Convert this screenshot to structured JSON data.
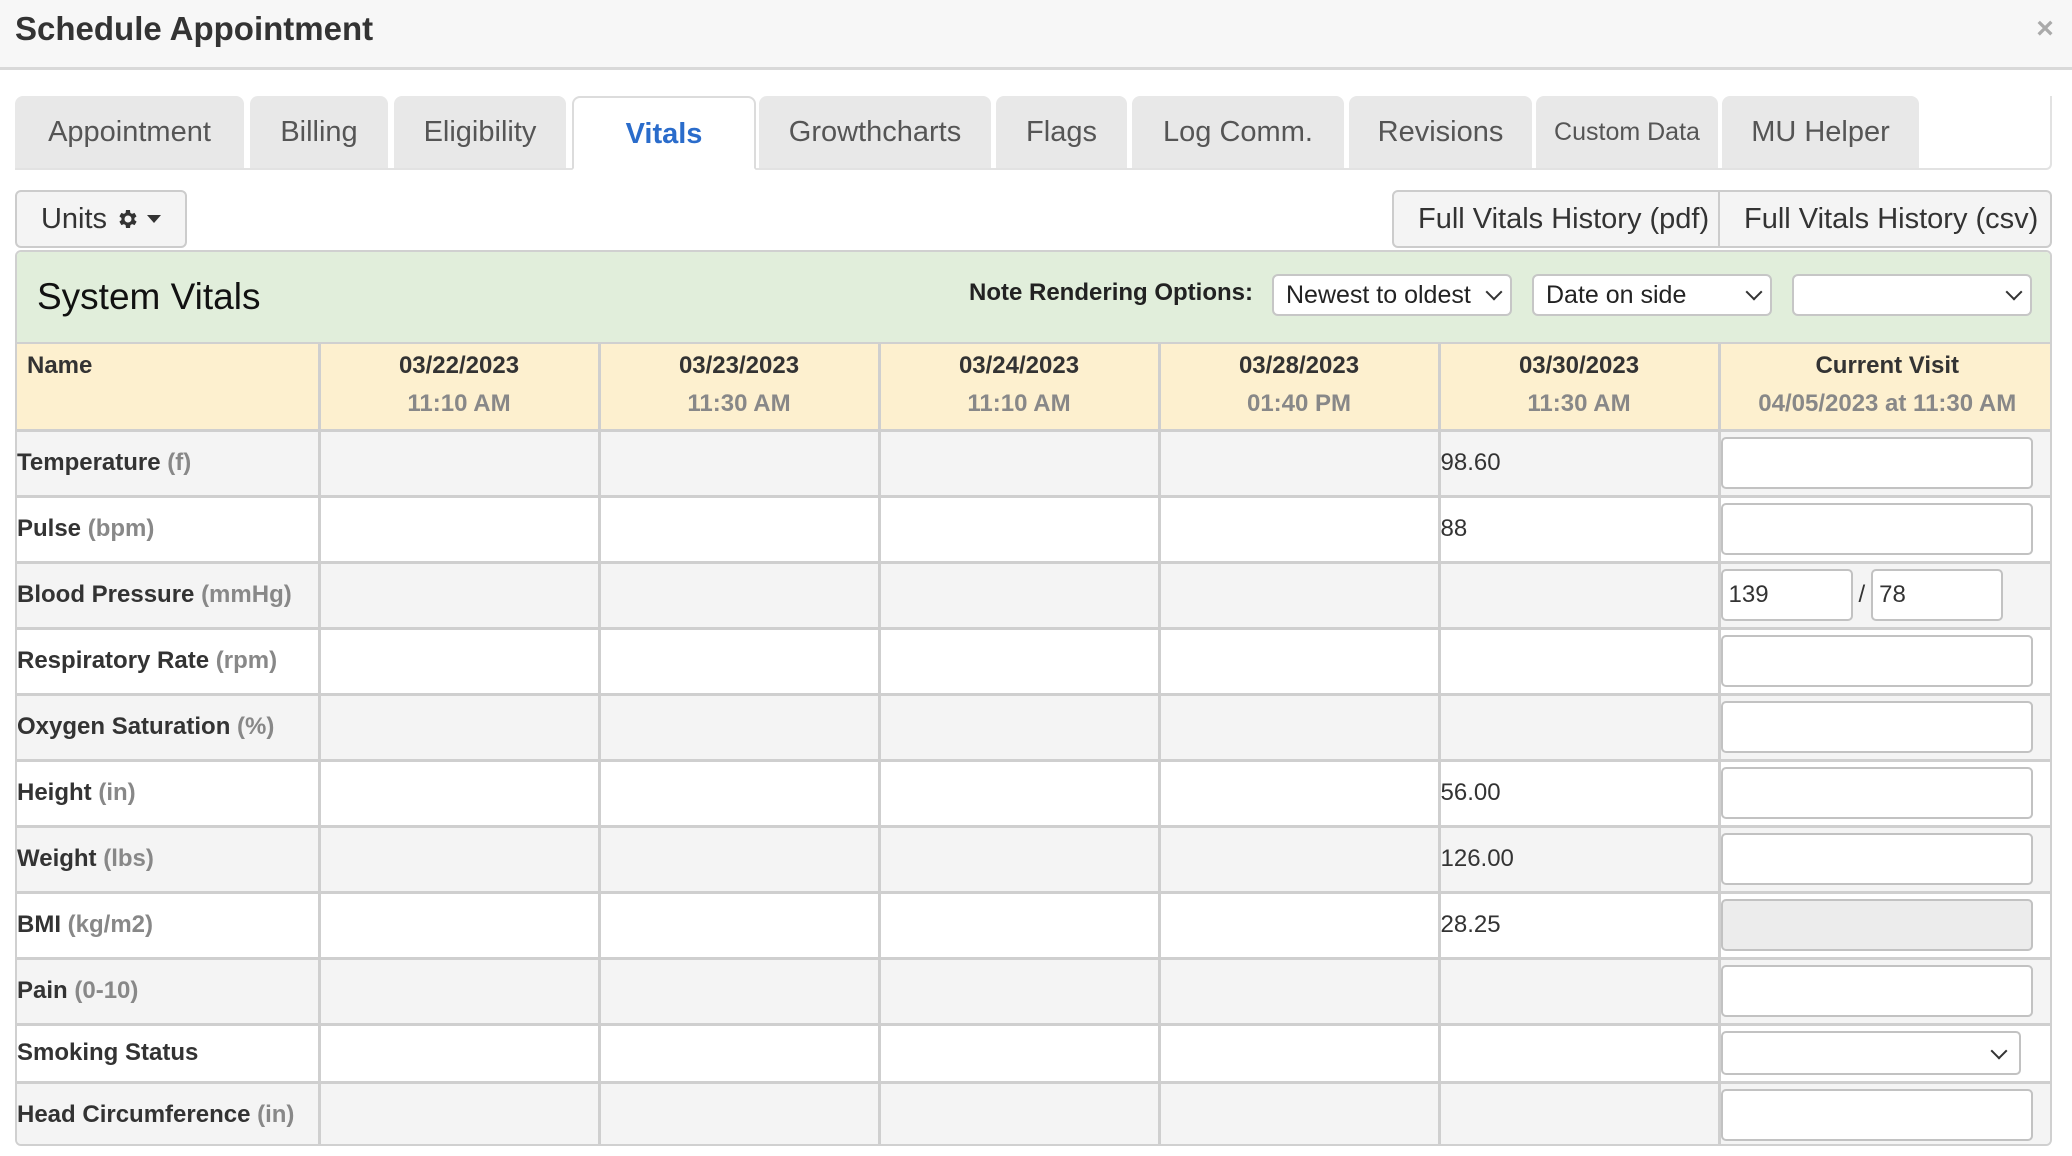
{
  "dialog": {
    "title": "Schedule Appointment",
    "close_icon": "×"
  },
  "tabs": [
    {
      "label": "Appointment",
      "active": false
    },
    {
      "label": "Billing",
      "active": false
    },
    {
      "label": "Eligibility",
      "active": false
    },
    {
      "label": "Vitals",
      "active": true
    },
    {
      "label": "Growthcharts",
      "active": false
    },
    {
      "label": "Flags",
      "active": false
    },
    {
      "label": "Log Comm.",
      "active": false
    },
    {
      "label": "Revisions",
      "active": false
    },
    {
      "label": "Custom Data",
      "active": false
    },
    {
      "label": "MU Helper",
      "active": false
    }
  ],
  "toolbar": {
    "units_label": "Units",
    "units_icon": "gear-icon",
    "pdf_label": "Full Vitals History (pdf)",
    "csv_label": "Full Vitals History (csv)"
  },
  "panel": {
    "title": "System Vitals",
    "note_rendering_label": "Note Rendering Options:",
    "order_select": "Newest to oldest",
    "date_select": "Date on side",
    "third_select": ""
  },
  "table": {
    "name_header": "Name",
    "columns": [
      {
        "date": "03/22/2023",
        "time": "11:10 AM"
      },
      {
        "date": "03/23/2023",
        "time": "11:30 AM"
      },
      {
        "date": "03/24/2023",
        "time": "11:10 AM"
      },
      {
        "date": "03/28/2023",
        "time": "01:40 PM"
      },
      {
        "date": "03/30/2023",
        "time": "11:30 AM"
      }
    ],
    "current_visit": {
      "title": "Current Visit",
      "subtitle": "04/05/2023 at 11:30 AM"
    },
    "rows": [
      {
        "name": "Temperature",
        "unit": "(f)",
        "values": [
          "",
          "",
          "",
          "",
          "98.60"
        ],
        "current": ""
      },
      {
        "name": "Pulse",
        "unit": "(bpm)",
        "values": [
          "",
          "",
          "",
          "",
          "88"
        ],
        "current": ""
      },
      {
        "name": "Blood Pressure",
        "unit": "(mmHg)",
        "values": [
          "",
          "",
          "",
          "",
          ""
        ],
        "current_systolic": "139",
        "current_diastolic": "78",
        "separator": "/"
      },
      {
        "name": "Respiratory Rate",
        "unit": "(rpm)",
        "values": [
          "",
          "",
          "",
          "",
          ""
        ],
        "current": ""
      },
      {
        "name": "Oxygen Saturation",
        "unit": "(%)",
        "values": [
          "",
          "",
          "",
          "",
          ""
        ],
        "current": ""
      },
      {
        "name": "Height",
        "unit": "(in)",
        "values": [
          "",
          "",
          "",
          "",
          "56.00"
        ],
        "current": ""
      },
      {
        "name": "Weight",
        "unit": "(lbs)",
        "values": [
          "",
          "",
          "",
          "",
          "126.00"
        ],
        "current": ""
      },
      {
        "name": "BMI",
        "unit": "(kg/m2)",
        "values": [
          "",
          "",
          "",
          "",
          "28.25"
        ],
        "current": ""
      },
      {
        "name": "Pain",
        "unit": "(0-10)",
        "values": [
          "",
          "",
          "",
          "",
          ""
        ],
        "current": ""
      },
      {
        "name": "Smoking Status",
        "unit": "",
        "values": [
          "",
          "",
          "",
          "",
          ""
        ],
        "current": ""
      },
      {
        "name": "Head Circumference",
        "unit": "(in)",
        "values": [
          "",
          "",
          "",
          "",
          ""
        ],
        "current": ""
      }
    ]
  },
  "colors": {
    "active_tab": "#2a6ccb",
    "panel_header_bg": "#e1eedb",
    "table_header_bg": "#fdf0cf"
  }
}
